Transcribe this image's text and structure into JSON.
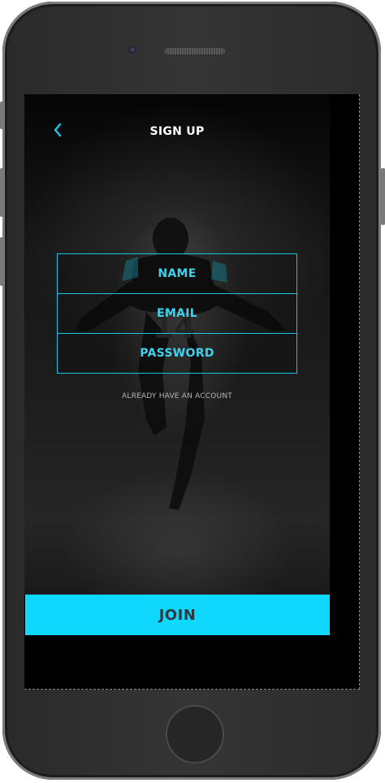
{
  "header": {
    "title": "SIGN UP"
  },
  "form": {
    "fields": [
      {
        "label": "NAME"
      },
      {
        "label": "EMAIL"
      },
      {
        "label": "PASSWORD"
      }
    ],
    "already_link": "ALREADY HAVE AN ACCOUNT"
  },
  "join_button": {
    "label": "JOIN"
  },
  "colors": {
    "accent": "#0fd8ff",
    "field_border": "#13c7ea",
    "field_text": "#3fd2ef"
  },
  "icons": {
    "back": "chevron-left-icon"
  }
}
